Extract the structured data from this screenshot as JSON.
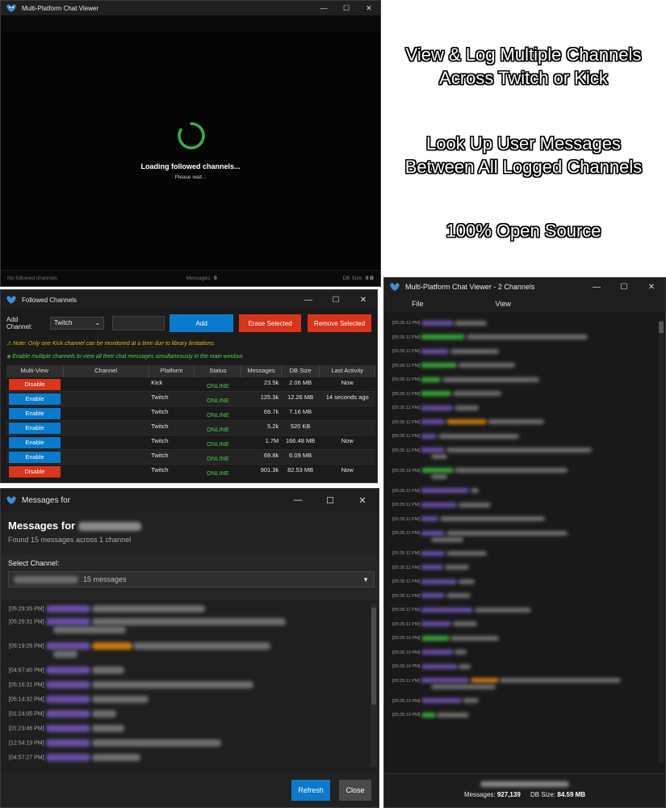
{
  "window_main": {
    "title": "Multi-Platform Chat Viewer",
    "loading_title": "Loading followed channels...",
    "loading_sub": "Please wait...",
    "status_left": "No followed channels",
    "status_messages_label": "Messages:",
    "status_messages_value": "0",
    "status_db_label": "DB Size:",
    "status_db_value": "0 B"
  },
  "promo": {
    "line1": "View & Log Multiple Channels",
    "line2": "Across Twitch or Kick",
    "line3": "Look Up User Messages",
    "line4": "Between All Logged Channels",
    "line5": "100% Open Source"
  },
  "followed": {
    "title": "Followed Channels",
    "add_label": "Add Channel:",
    "platform_value": "Twitch",
    "add_button": "Add",
    "erase_button": "Erase Selected",
    "remove_button": "Remove Selected",
    "note_kick": "Note: Only one Kick channel can be monitored at a time due to library limitations.",
    "note_multi": "Enable multiple channels to view all their chat messages simultaneously in the main window.",
    "columns": [
      "Multi-View",
      "Channel",
      "Platform",
      "Status",
      "Messages",
      "DB Size",
      "Last Activity"
    ],
    "rows": [
      {
        "action": "Disable",
        "platform": "Kick",
        "status": "ONLINE",
        "messages": "23.5k",
        "db": "2.06 MB",
        "last": "Now"
      },
      {
        "action": "Enable",
        "platform": "Twitch",
        "status": "ONLINE",
        "messages": "125.3k",
        "db": "12.26 MB",
        "last": "14 seconds ago"
      },
      {
        "action": "Enable",
        "platform": "Twitch",
        "status": "ONLINE",
        "messages": "69.7k",
        "db": "7.16 MB",
        "last": ""
      },
      {
        "action": "Enable",
        "platform": "Twitch",
        "status": "ONLINE",
        "messages": "5.2k",
        "db": "520 KB",
        "last": ""
      },
      {
        "action": "Enable",
        "platform": "Twitch",
        "status": "ONLINE",
        "messages": "1.7M",
        "db": "166.48 MB",
        "last": "Now"
      },
      {
        "action": "Enable",
        "platform": "Twitch",
        "status": "ONLINE",
        "messages": "69.8k",
        "db": "6.09 MB",
        "last": ""
      },
      {
        "action": "Disable",
        "platform": "Twitch",
        "status": "ONLINE",
        "messages": "901.3k",
        "db": "82.53 MB",
        "last": "Now"
      }
    ]
  },
  "messages_for": {
    "title": "Messages for",
    "heading": "Messages for",
    "found": "Found 15 messages across 1 channel",
    "select_label": "Select Channel:",
    "select_count": "15 messages",
    "timestamps": [
      "[05:29:35 PM]",
      "[05:26:31 PM]",
      "[05:19:28 PM]",
      "[04:57:40 PM]",
      "[05:16:31 PM]",
      "[05:14:32 PM]",
      "[01:24:05 PM]",
      "[01:23:46 PM]",
      "[12:54:19 PM]",
      "[04:57:27 PM]"
    ],
    "refresh": "Refresh",
    "close": "Close"
  },
  "chat_viewer": {
    "title": "Multi-Platform Chat Viewer - 2 Channels",
    "menu_file": "File",
    "menu_view": "View",
    "first_timestamp": "[05:35:12 PM]",
    "timestamps_11": "[05:35:11 PM]",
    "timestamps_10": "[05:35:10 PM]",
    "messages_label": "Messages:",
    "messages_value": "927,139",
    "db_label": "DB Size:",
    "db_value": "84.59 MB"
  },
  "colors": {
    "accent_blue": "#0a7acc",
    "danger_red": "#d9341c",
    "online_green": "#4ec54e",
    "spinner_green": "#3cb043"
  }
}
